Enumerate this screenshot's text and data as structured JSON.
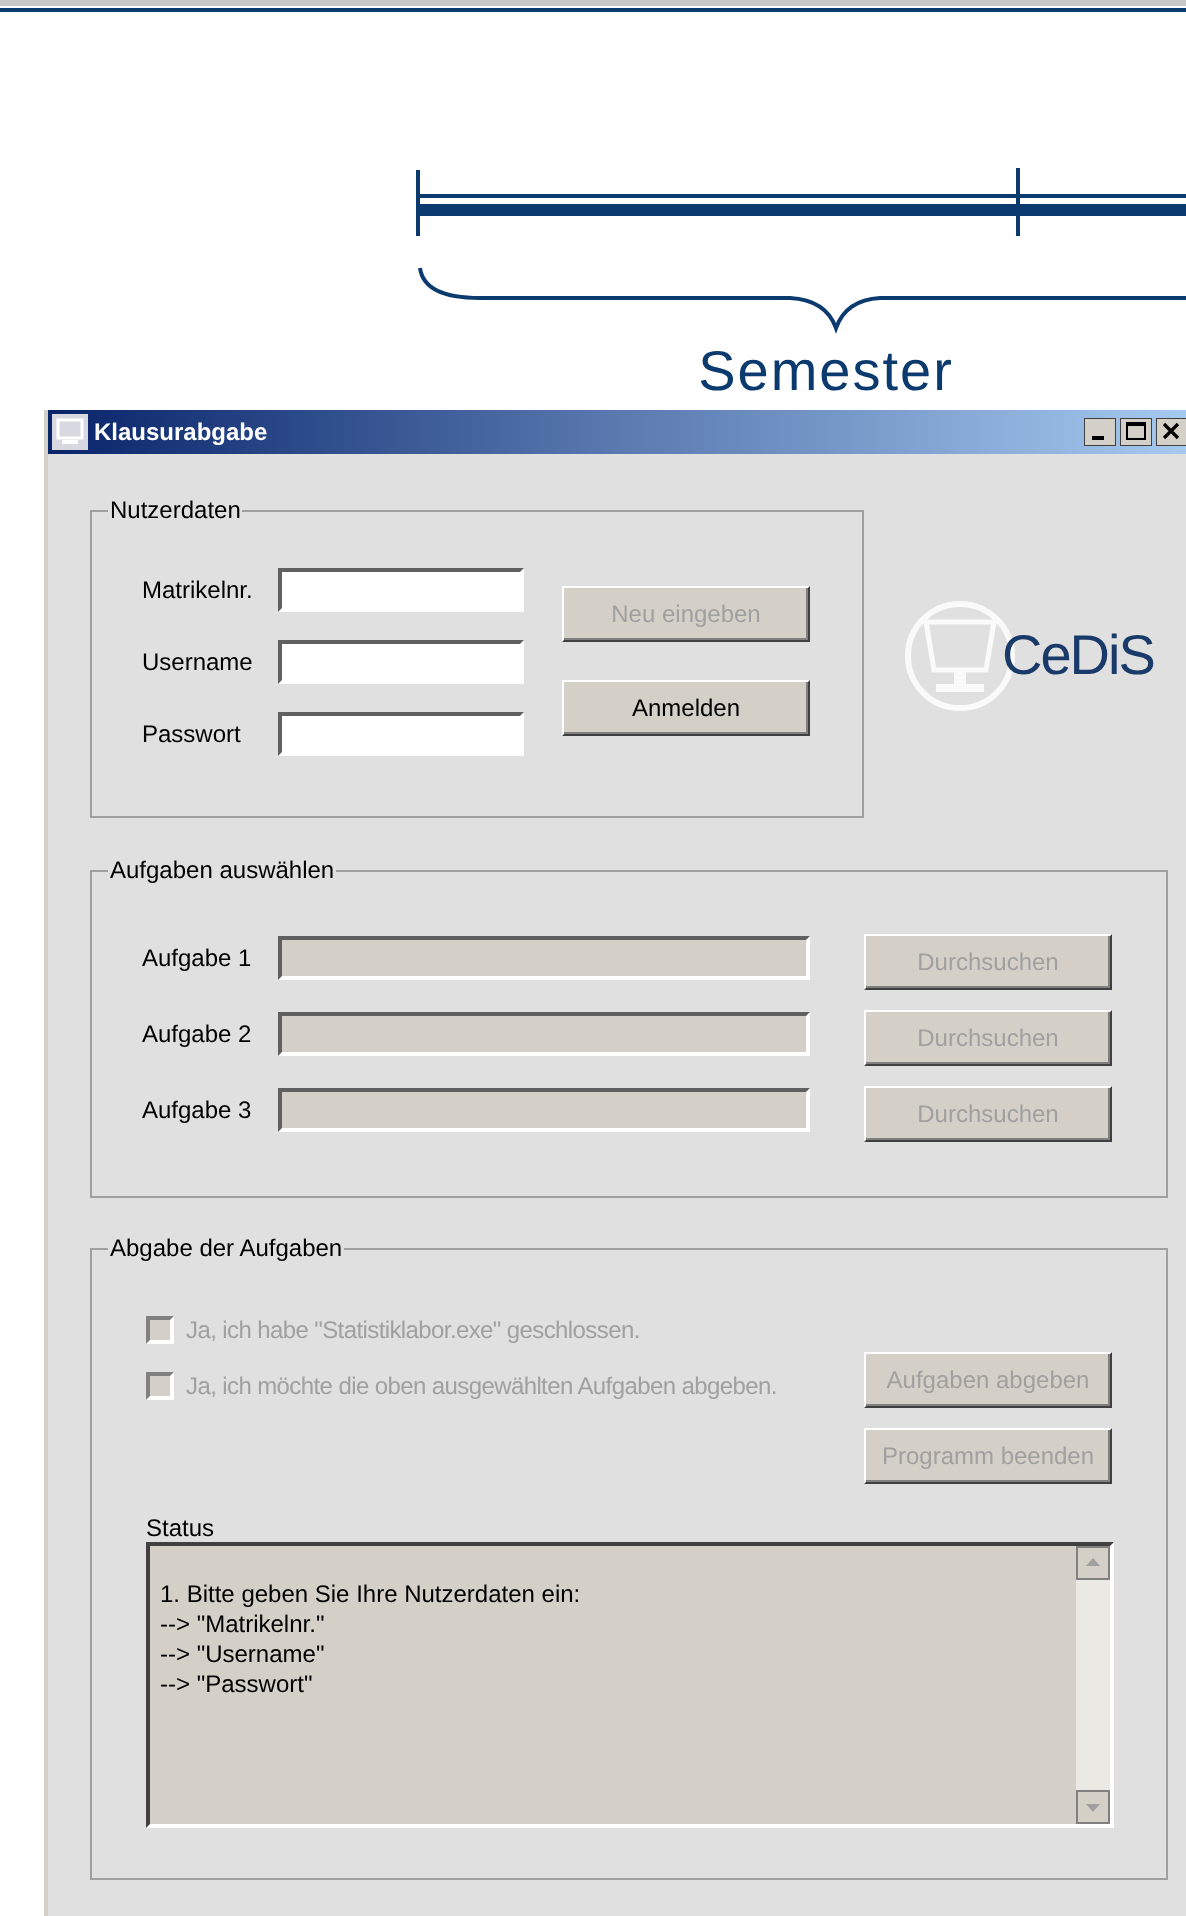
{
  "diagram": {
    "label": "Semester"
  },
  "window": {
    "title": "Klausurabgabe"
  },
  "login_group": {
    "title": "Nutzerdaten",
    "fields": [
      {
        "label": "Matrikelnr."
      },
      {
        "label": "Username"
      },
      {
        "label": "Passwort"
      }
    ],
    "buttons": [
      {
        "label": "Neu eingeben",
        "disabled": true
      },
      {
        "label": "Anmelden",
        "disabled": false
      }
    ]
  },
  "logo": {
    "text": "CeDiS"
  },
  "tasks_group": {
    "title": "Aufgaben auswählen",
    "rows": [
      {
        "label": "Aufgabe 1",
        "button": "Durchsuchen",
        "disabled": true
      },
      {
        "label": "Aufgabe 2",
        "button": "Durchsuchen",
        "disabled": true
      },
      {
        "label": "Aufgabe 3",
        "button": "Durchsuchen",
        "disabled": true
      }
    ]
  },
  "submit_group": {
    "title": "Abgabe der Aufgaben",
    "checkboxes": [
      {
        "label": "Ja, ich habe \"Statistiklabor.exe\" geschlossen.",
        "checked": false,
        "disabled": true
      },
      {
        "label": "Ja, ich möchte die oben ausgewählten Aufgaben abgeben.",
        "checked": false,
        "disabled": true
      }
    ],
    "buttons": [
      {
        "label": "Aufgaben abgeben",
        "disabled": true
      },
      {
        "label": "Programm beenden",
        "disabled": true
      }
    ],
    "status_label": "Status",
    "status_lines": [
      "1. Bitte geben Sie Ihre Nutzerdaten ein:",
      "--> \"Matrikelnr.\"",
      "--> \"Username\"",
      "--> \"Passwort\""
    ]
  }
}
